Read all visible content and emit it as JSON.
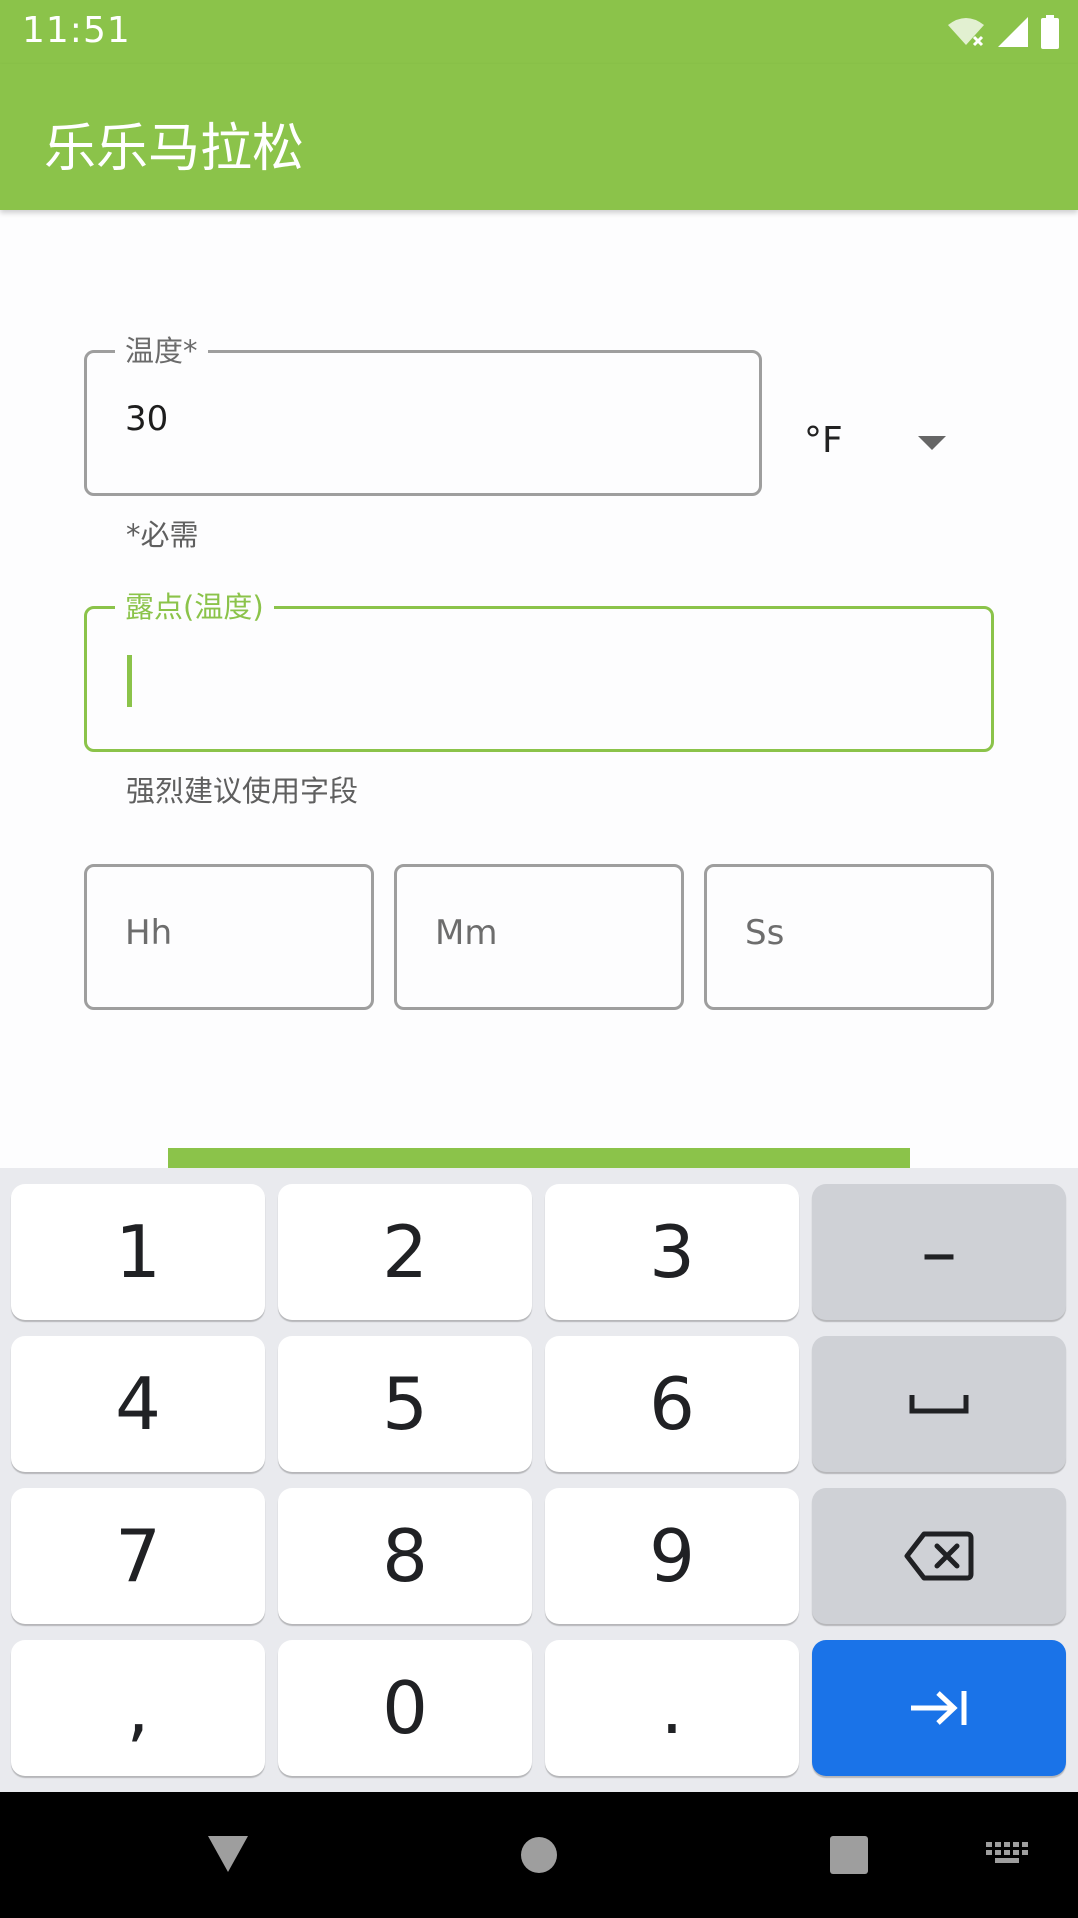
{
  "status_bar": {
    "time": "11:51"
  },
  "app_bar": {
    "title": "乐乐马拉松"
  },
  "temperature": {
    "label": "温度*",
    "value": "30",
    "helper": "*必需",
    "unit": "°F"
  },
  "dew_point": {
    "label": "露点(温度)",
    "value": "",
    "helper": "强烈建议使用字段"
  },
  "time_fields": {
    "hours_placeholder": "Hh",
    "minutes_placeholder": "Mm",
    "seconds_placeholder": "Ss"
  },
  "keyboard": {
    "rows": [
      [
        "1",
        "2",
        "3",
        "–"
      ],
      [
        "4",
        "5",
        "6",
        "space"
      ],
      [
        "7",
        "8",
        "9",
        "backspace"
      ],
      [
        ",",
        "0",
        ".",
        "next"
      ]
    ]
  },
  "colors": {
    "primary": "#8bc34a",
    "enter_key": "#1a73e8"
  }
}
